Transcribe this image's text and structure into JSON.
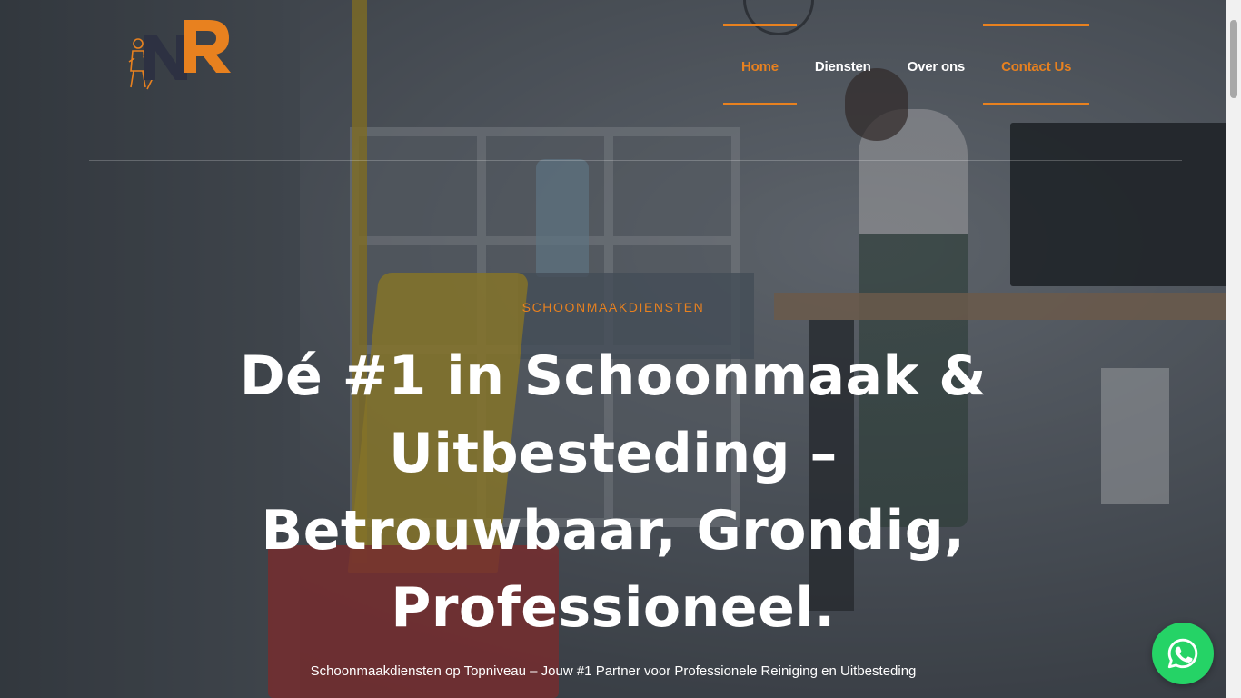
{
  "brand": {
    "logo_text": "NR",
    "accent_color": "#e8811f",
    "logo_dark_color": "#2d3142"
  },
  "nav": {
    "items": [
      {
        "label": "Home",
        "state": "active"
      },
      {
        "label": "Diensten",
        "state": "normal"
      },
      {
        "label": "Over ons",
        "state": "normal"
      },
      {
        "label": "Contact Us",
        "state": "highlighted"
      }
    ]
  },
  "hero": {
    "eyebrow": "SCHOONMAAKDIENSTEN",
    "headline": "Dé #1 in Schoonmaak & Uitbesteding – Betrouwbaar, Grondig, Professioneel.",
    "subtitle": "Schoonmaakdiensten op Topniveau – Jouw #1 Partner voor Professionele Reiniging en Uitbesteding"
  },
  "floating_button": {
    "icon": "whatsapp-icon",
    "color": "#25d366"
  }
}
